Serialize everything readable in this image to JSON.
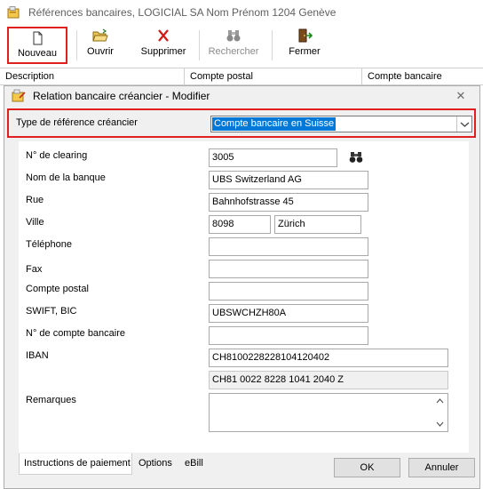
{
  "window": {
    "title": "Références bancaires, LOGICIAL SA Nom Prénom 1204 Genève"
  },
  "toolbar": {
    "new_label": "Nouveau",
    "open_label": "Ouvrir",
    "delete_label": "Supprimer",
    "search_label": "Rechercher",
    "close_label": "Fermer"
  },
  "grid": {
    "columns": [
      "Description",
      "Compte postal",
      "Compte bancaire"
    ]
  },
  "dialog": {
    "title": "Relation bancaire créancier - Modifier",
    "type_label": "Type de référence créancier",
    "type_value": "Compte bancaire en Suisse",
    "fields": {
      "clearing_label": "N° de clearing",
      "clearing_value": "3005",
      "bank_name_label": "Nom de la banque",
      "bank_name_value": "UBS Switzerland AG",
      "street_label": "Rue",
      "street_value": "Bahnhofstrasse 45",
      "city_label": "Ville",
      "zip_value": "8098",
      "city_value": "Zürich",
      "phone_label": "Téléphone",
      "phone_value": "",
      "fax_label": "Fax",
      "fax_value": "",
      "postal_account_label": "Compte postal",
      "postal_account_value": "",
      "swift_label": "SWIFT, BIC",
      "swift_value": "UBSWCHZH80A",
      "bank_account_label": "N° de compte bancaire",
      "bank_account_value": "",
      "iban_label": "IBAN",
      "iban_value": "CH8100228228104120402",
      "iban_formatted": "CH81 0022 8228 1041 2040 Z",
      "remarks_label": "Remarques",
      "remarks_value": ""
    },
    "tabs": [
      "Instructions de paiement",
      "Options",
      "eBill"
    ],
    "ok_label": "OK",
    "cancel_label": "Annuler"
  },
  "colors": {
    "highlight_border": "#e02020",
    "selection": "#0078d7"
  }
}
